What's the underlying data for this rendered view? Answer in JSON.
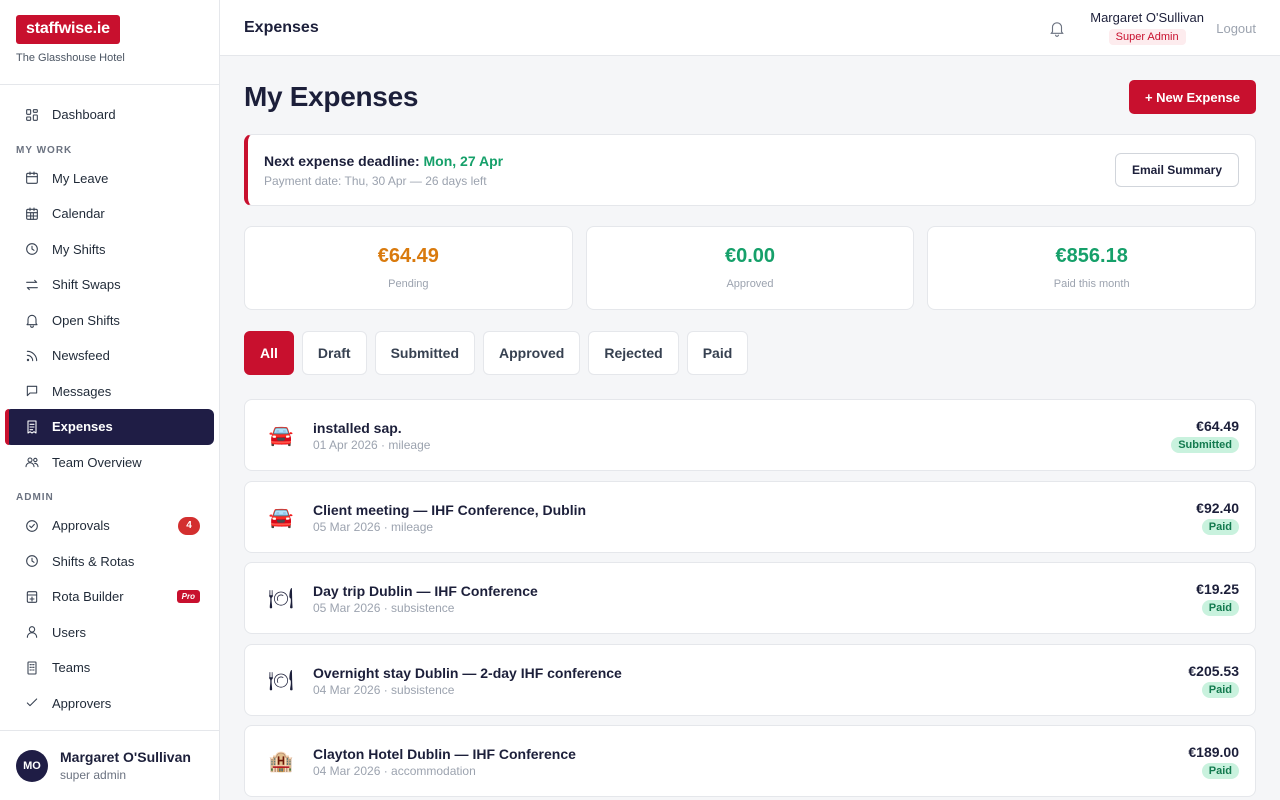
{
  "brand": {
    "logo": "staffwise.ie",
    "org": "The Glasshouse Hotel"
  },
  "sidebar": {
    "top_items": [
      {
        "label": "Dashboard",
        "icon": "grid-icon"
      }
    ],
    "my_work_label": "MY WORK",
    "my_work": [
      {
        "label": "My Leave",
        "icon": "calendar-icon"
      },
      {
        "label": "Calendar",
        "icon": "calendar-grid-icon"
      },
      {
        "label": "My Shifts",
        "icon": "clock-icon"
      },
      {
        "label": "Shift Swaps",
        "icon": "swap-icon"
      },
      {
        "label": "Open Shifts",
        "icon": "bell-icon"
      },
      {
        "label": "Newsfeed",
        "icon": "rss-icon"
      },
      {
        "label": "Messages",
        "icon": "message-icon"
      },
      {
        "label": "Expenses",
        "icon": "receipt-icon",
        "active": true
      },
      {
        "label": "Team Overview",
        "icon": "team-icon"
      }
    ],
    "admin_label": "ADMIN",
    "admin": [
      {
        "label": "Approvals",
        "icon": "check-circle-icon",
        "badge": "4"
      },
      {
        "label": "Shifts & Rotas",
        "icon": "clock-icon"
      },
      {
        "label": "Rota Builder",
        "icon": "builder-icon",
        "pro": "Pro"
      },
      {
        "label": "Users",
        "icon": "user-icon"
      },
      {
        "label": "Teams",
        "icon": "building-icon"
      },
      {
        "label": "Approvers",
        "icon": "check-icon"
      }
    ],
    "user": {
      "initials": "MO",
      "name": "Margaret O'Sullivan",
      "role": "super admin"
    }
  },
  "topbar": {
    "title": "Expenses",
    "user_name": "Margaret O'Sullivan",
    "user_role": "Super Admin",
    "logout": "Logout"
  },
  "page": {
    "title": "My Expenses",
    "new_button": "+ New Expense"
  },
  "deadline": {
    "label": "Next expense deadline:",
    "date": "Mon, 27 Apr",
    "sub": "Payment date: Thu, 30 Apr — 26 days left",
    "email_button": "Email Summary"
  },
  "stats": [
    {
      "value": "€64.49",
      "label": "Pending",
      "color": "#d97a0d"
    },
    {
      "value": "€0.00",
      "label": "Approved",
      "color": "#16a06a"
    },
    {
      "value": "€856.18",
      "label": "Paid this month",
      "color": "#16a06a"
    }
  ],
  "filters": [
    "All",
    "Draft",
    "Submitted",
    "Approved",
    "Rejected",
    "Paid"
  ],
  "active_filter": "All",
  "expenses": [
    {
      "icon": "🚘",
      "icon_name": "car-icon",
      "title": "installed sap.",
      "meta": "01 Apr 2026 · mileage",
      "amount": "€64.49",
      "status": "Submitted"
    },
    {
      "icon": "🚘",
      "icon_name": "car-icon",
      "title": "Client meeting — IHF Conference, Dublin",
      "meta": "05 Mar 2026 · mileage",
      "amount": "€92.40",
      "status": "Paid"
    },
    {
      "icon": "🍽",
      "icon_name": "plate-icon",
      "title": "Day trip Dublin — IHF Conference",
      "meta": "05 Mar 2026 · subsistence",
      "amount": "€19.25",
      "status": "Paid"
    },
    {
      "icon": "🍽",
      "icon_name": "plate-icon",
      "title": "Overnight stay Dublin — 2-day IHF conference",
      "meta": "04 Mar 2026 · subsistence",
      "amount": "€205.53",
      "status": "Paid"
    },
    {
      "icon": "🏨",
      "icon_name": "hotel-icon",
      "title": "Clayton Hotel Dublin — IHF Conference",
      "meta": "04 Mar 2026 · accommodation",
      "amount": "€189.00",
      "status": "Paid"
    }
  ]
}
